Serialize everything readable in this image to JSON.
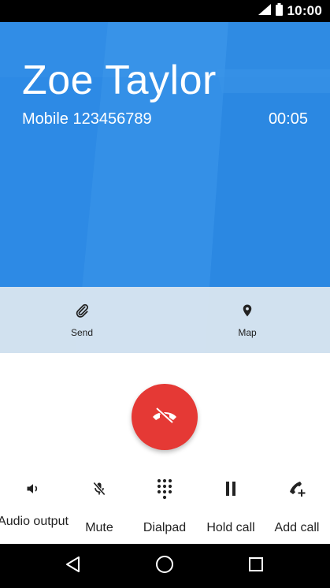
{
  "status_bar": {
    "time": "10:00",
    "icons": [
      "signal-icon",
      "battery-icon"
    ]
  },
  "call": {
    "name": "Zoe Taylor",
    "number": "Mobile 123456789",
    "duration": "00:05"
  },
  "quick_actions": [
    {
      "label": "Send",
      "icon": "paperclip-icon"
    },
    {
      "label": "Map",
      "icon": "location-pin-icon"
    }
  ],
  "end_call": {
    "icon": "end-call-icon",
    "color": "#e53935"
  },
  "controls": [
    {
      "label": "Audio output",
      "icon": "speaker-icon"
    },
    {
      "label": "Mute",
      "icon": "mic-off-icon"
    },
    {
      "label": "Dialpad",
      "icon": "dialpad-icon"
    },
    {
      "label": "Hold call",
      "icon": "pause-icon"
    },
    {
      "label": "Add call",
      "icon": "add-call-icon"
    }
  ],
  "nav": [
    "back-icon",
    "home-icon",
    "recents-icon"
  ],
  "colors": {
    "hero": "#2e8ce6",
    "end_call": "#e53935",
    "status_bar": "#000000"
  }
}
